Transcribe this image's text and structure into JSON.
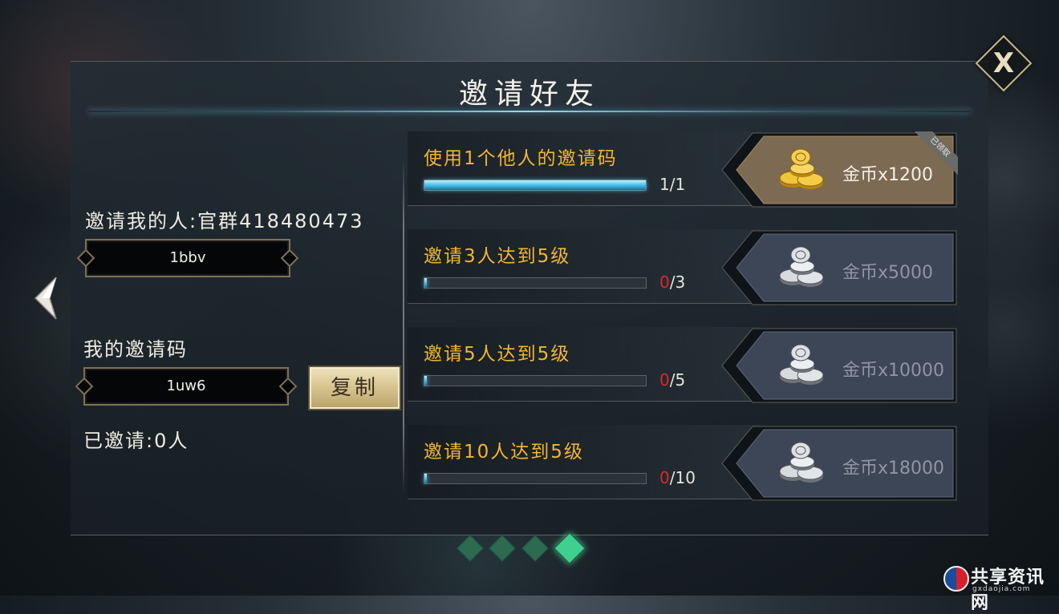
{
  "title": "邀请好友",
  "close_label": "X",
  "inviter": {
    "label": "邀请我的人:官群418480473",
    "value": "1bbv"
  },
  "my_code": {
    "label": "我的邀请码",
    "value": "1uw6",
    "copy_label": "复制"
  },
  "invited_count": "已邀请:0人",
  "tasks": [
    {
      "name": "使用1个他人的邀请码",
      "current": "1",
      "total": "/1",
      "progress": 1.0,
      "reward": "金币x1200",
      "coin": "gold-coins-icon",
      "claimed": true
    },
    {
      "name": "邀请3人达到5级",
      "current": "0",
      "total": "/3",
      "progress": 0.0,
      "reward": "金币x5000",
      "coin": "silver-coins-icon",
      "claimed": false
    },
    {
      "name": "邀请5人达到5级",
      "current": "0",
      "total": "/5",
      "progress": 0.0,
      "reward": "金币x10000",
      "coin": "silver-coins-icon",
      "claimed": false
    },
    {
      "name": "邀请10人达到5级",
      "current": "0",
      "total": "/10",
      "progress": 0.0,
      "reward": "金币x18000",
      "coin": "silver-coins-icon",
      "claimed": false
    }
  ],
  "claimed_tag": "已领取",
  "pager": {
    "count": 4,
    "active": 4
  },
  "watermark": {
    "text": "共享资讯网",
    "sub": "gxdaojia.com"
  },
  "colors": {
    "accent_gold": "#f2b632",
    "red": "#e0262a",
    "progress_cyan": "#38b4e0",
    "pager_active": "#3fcf8e"
  }
}
